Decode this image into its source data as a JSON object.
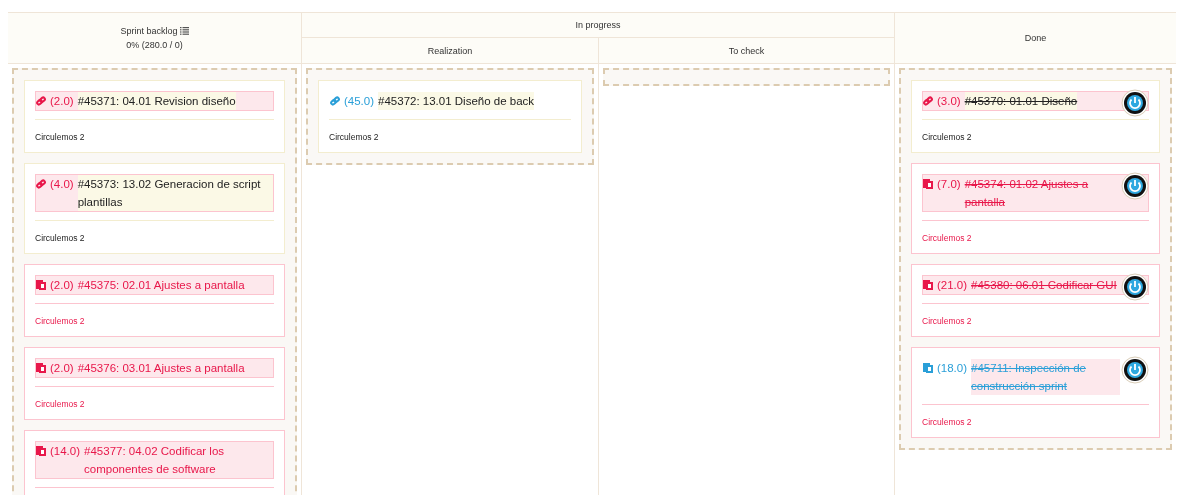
{
  "header": {
    "backlog": {
      "title": "Sprint backlog",
      "summary": "0% (280.0 / 0)"
    },
    "in_progress": {
      "title": "In progress",
      "subcolumns": [
        "Realization",
        "To check"
      ]
    },
    "done": {
      "title": "Done"
    }
  },
  "lanes": [
    {
      "cards": [
        {
          "kind": "link",
          "color": "#e8174a",
          "flagged": true,
          "alert": false,
          "done": false,
          "points": "(2.0)",
          "title": "#45371: 04.01 Revision diseño",
          "footer": "Circulemos 2"
        },
        {
          "kind": "link",
          "color": "#e8174a",
          "flagged": true,
          "alert": false,
          "done": false,
          "points": "(4.0)",
          "title": "#45373: 13.02 Generacion de script plantillas",
          "footer": "Circulemos 2"
        },
        {
          "kind": "copy",
          "color": "#e8174a",
          "flagged": true,
          "alert": true,
          "done": false,
          "points": "(2.0)",
          "title": "#45375: 02.01 Ajustes a pantalla",
          "footer": "Circulemos 2"
        },
        {
          "kind": "copy",
          "color": "#e8174a",
          "flagged": true,
          "alert": true,
          "done": false,
          "points": "(2.0)",
          "title": "#45376: 03.01 Ajustes a pantalla",
          "footer": "Circulemos 2"
        },
        {
          "kind": "copy",
          "color": "#e8174a",
          "flagged": true,
          "alert": true,
          "done": false,
          "points": "(14.0)",
          "title": "#45377: 04.02 Codificar los componentes de software"
        }
      ]
    },
    {
      "cards": [
        {
          "kind": "link",
          "color": "#2a9fd8",
          "flagged": false,
          "alert": false,
          "done": false,
          "points": "(45.0)",
          "title": "#45372: 13.01 Diseño de back",
          "footer": "Circulemos 2"
        }
      ]
    },
    {
      "empty": true
    },
    {
      "cards": [
        {
          "kind": "link",
          "color": "#e8174a",
          "flagged": true,
          "alert": false,
          "done": true,
          "points": "(3.0)",
          "title": "#45370: 01.01 Diseño",
          "footer": "Circulemos 2"
        },
        {
          "kind": "copy",
          "color": "#e8174a",
          "flagged": true,
          "alert": true,
          "done": true,
          "points": "(7.0)",
          "title": "#45374: 01.02 Ajustes a pantalla",
          "footer": "Circulemos 2"
        },
        {
          "kind": "copy",
          "color": "#e8174a",
          "flagged": true,
          "alert": true,
          "done": true,
          "points": "(21.0)",
          "title": "#45380: 06.01 Codificar GUI",
          "footer": "Circulemos 2"
        },
        {
          "kind": "copy",
          "color": "#2a9fd8",
          "flagged": false,
          "alert": true,
          "done": true,
          "points": "(18.0)",
          "title": "#45711: Inspección de construcción sprint",
          "footer": "Circulemos 2"
        }
      ]
    }
  ]
}
